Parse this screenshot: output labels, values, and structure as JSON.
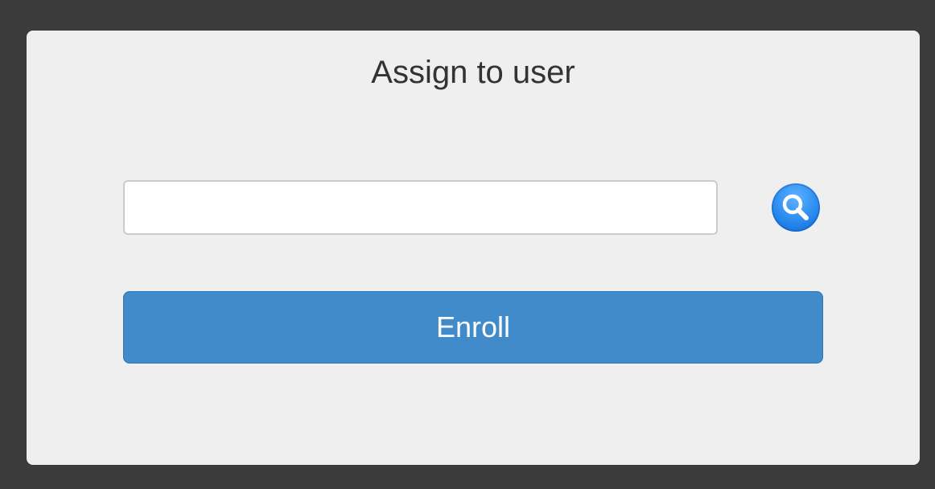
{
  "dialog": {
    "title": "Assign to user",
    "user_input": {
      "value": "",
      "placeholder": ""
    },
    "search_icon": "search-icon",
    "enroll_label": "Enroll"
  },
  "colors": {
    "background": "#3b3b3b",
    "panel": "#efefef",
    "accent": "#428bca",
    "search_button": "#2a8cf0"
  }
}
